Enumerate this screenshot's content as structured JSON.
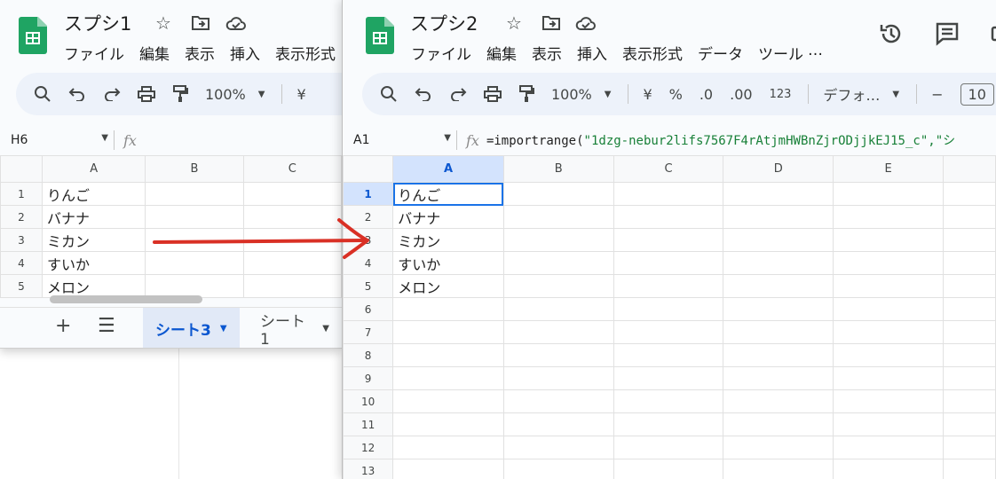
{
  "window1": {
    "title": "スプシ1",
    "menu": [
      "ファイル",
      "編集",
      "表示",
      "挿入",
      "表示形式"
    ],
    "toolbar": {
      "zoom": "100%",
      "currency": "¥"
    },
    "name_box": "H6",
    "fx_label": "fx",
    "columns": [
      "A",
      "B",
      "C"
    ],
    "rows": [
      {
        "num": "1",
        "a": "りんご"
      },
      {
        "num": "2",
        "a": "バナナ"
      },
      {
        "num": "3",
        "a": "ミカン"
      },
      {
        "num": "4",
        "a": "すいか"
      },
      {
        "num": "5",
        "a": "メロン"
      }
    ],
    "tabs": [
      {
        "label": "シート3",
        "active": true
      },
      {
        "label": "シート1",
        "active": false
      }
    ]
  },
  "window2": {
    "title": "スプシ2",
    "menu": [
      "ファイル",
      "編集",
      "表示",
      "挿入",
      "表示形式",
      "データ",
      "ツール",
      "…"
    ],
    "toolbar": {
      "zoom": "100%",
      "currency": "¥",
      "percent": "%",
      "dec_decrease": ".0",
      "dec_increase": ".00",
      "number_format": "123",
      "font": "デフォ…",
      "font_size": "10"
    },
    "name_box": "A1",
    "fx_label": "fx",
    "formula_fn": "=importrange(",
    "formula_arg1": "\"1dzg-nebur2lifs7567F4rAtjmHWBnZjrODjjkEJ15_c\"",
    "formula_rest": ",\"シ",
    "columns": [
      "A",
      "B",
      "C",
      "D",
      "E"
    ],
    "rows": [
      {
        "num": "1",
        "a": "りんご"
      },
      {
        "num": "2",
        "a": "バナナ"
      },
      {
        "num": "3",
        "a": "ミカン"
      },
      {
        "num": "4",
        "a": "すいか"
      },
      {
        "num": "5",
        "a": "メロン"
      },
      {
        "num": "6",
        "a": ""
      },
      {
        "num": "7",
        "a": ""
      },
      {
        "num": "8",
        "a": ""
      },
      {
        "num": "9",
        "a": ""
      },
      {
        "num": "10",
        "a": ""
      },
      {
        "num": "11",
        "a": ""
      },
      {
        "num": "12",
        "a": ""
      },
      {
        "num": "13",
        "a": ""
      }
    ]
  },
  "colors": {
    "accent": "#0b57d0",
    "selection": "#1a73e8",
    "sheets_green": "#1fa463",
    "annotation_arrow": "#d93025"
  },
  "icons": {
    "header": [
      "star-icon",
      "move-to-folder-icon",
      "cloud-saved-icon",
      "history-icon",
      "comment-icon"
    ],
    "toolbar": [
      "search-icon",
      "undo-icon",
      "redo-icon",
      "print-icon",
      "paint-format-icon"
    ]
  }
}
